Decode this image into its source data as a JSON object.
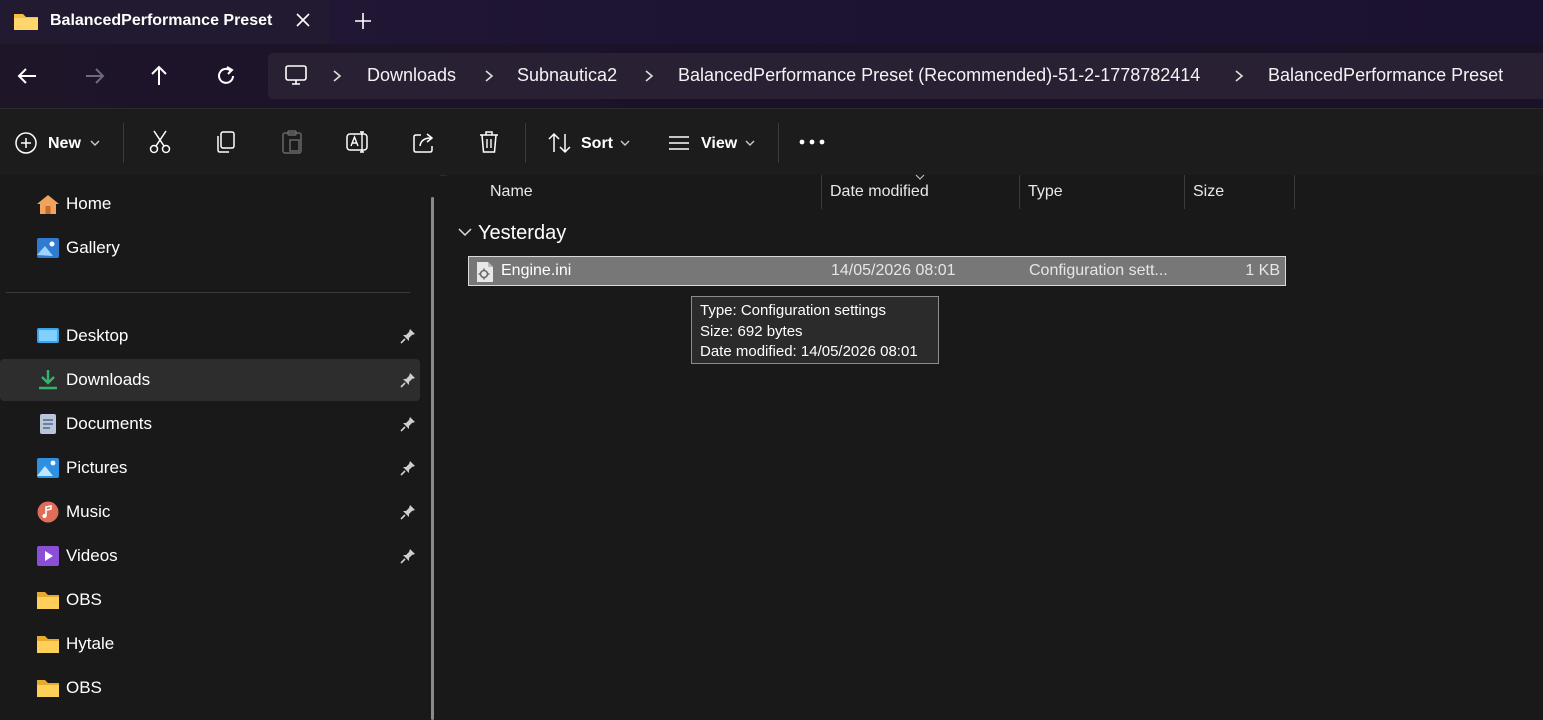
{
  "tab": {
    "title": "BalancedPerformance Preset",
    "close_icon": "close-icon",
    "new_tab_icon": "plus-icon"
  },
  "nav": {
    "back_icon": "arrow-left-icon",
    "forward_icon": "arrow-right-icon",
    "up_icon": "arrow-up-icon",
    "refresh_icon": "refresh-icon"
  },
  "breadcrumb": [
    "Downloads",
    "Subnautica2",
    "BalancedPerformance Preset (Recommended)-51-2-1778782414",
    "BalancedPerformance Preset"
  ],
  "toolbar": {
    "new_label": "New",
    "sort_label": "Sort",
    "view_label": "View"
  },
  "sidebar": {
    "quick": [
      {
        "label": "Home",
        "icon": "home-icon"
      },
      {
        "label": "Gallery",
        "icon": "gallery-icon"
      }
    ],
    "pinned": [
      {
        "label": "Desktop",
        "icon": "desktop-icon",
        "pinned": true
      },
      {
        "label": "Downloads",
        "icon": "download-icon",
        "pinned": true,
        "selected": true
      },
      {
        "label": "Documents",
        "icon": "document-icon",
        "pinned": true
      },
      {
        "label": "Pictures",
        "icon": "pictures-icon",
        "pinned": true
      },
      {
        "label": "Music",
        "icon": "music-icon",
        "pinned": true
      },
      {
        "label": "Videos",
        "icon": "videos-icon",
        "pinned": true
      },
      {
        "label": "OBS",
        "icon": "folder-icon",
        "pinned": false
      },
      {
        "label": "Hytale",
        "icon": "folder-icon",
        "pinned": false
      },
      {
        "label": "OBS",
        "icon": "folder-icon",
        "pinned": false
      }
    ]
  },
  "list": {
    "columns": [
      "Name",
      "Date modified",
      "Type",
      "Size"
    ],
    "group": "Yesterday",
    "files": [
      {
        "name": "Engine.ini",
        "date": "14/05/2026 08:01",
        "type": "Configuration sett...",
        "size": "1 KB"
      }
    ]
  },
  "tooltip": {
    "type": "Type: Configuration settings",
    "size": "Size: 692 bytes",
    "date": "Date modified: 14/05/2026 08:01"
  },
  "colors": {
    "folder": "#f5c042",
    "accent": "#3a8fd8",
    "selection": "#777777"
  }
}
